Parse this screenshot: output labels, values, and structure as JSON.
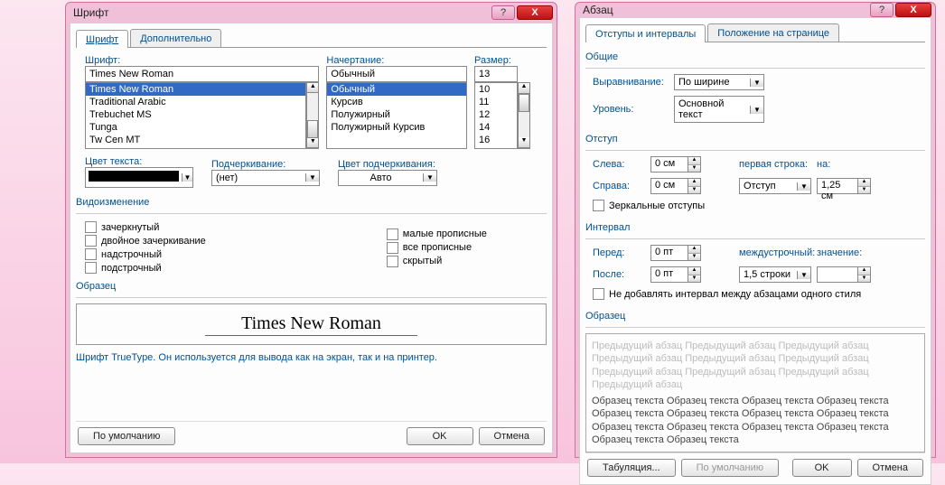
{
  "font_dialog": {
    "title": "Шрифт",
    "tabs": {
      "font": "Шрифт",
      "advanced": "Дополнительно"
    },
    "labels": {
      "font": "Шрифт:",
      "style": "Начертание:",
      "size": "Размер:",
      "text_color": "Цвет текста:",
      "underline": "Подчеркивание:",
      "underline_color": "Цвет подчеркивания:",
      "effects": "Видоизменение",
      "sample": "Образец"
    },
    "font_value": "Times New Roman",
    "font_list": [
      "Times New Roman",
      "Traditional Arabic",
      "Trebuchet MS",
      "Tunga",
      "Tw Cen MT"
    ],
    "style_value": "Обычный",
    "style_list": [
      "Обычный",
      "Курсив",
      "Полужирный",
      "Полужирный Курсив"
    ],
    "size_value": "13",
    "size_list": [
      "10",
      "11",
      "12",
      "14",
      "16"
    ],
    "underline_value": "(нет)",
    "underline_color_value": "Авто",
    "effects": {
      "strike": "зачеркнутый",
      "dstrike": "двойное зачеркивание",
      "super": "надстрочный",
      "sub": "подстрочный",
      "smallcaps": "малые прописные",
      "allcaps": "все прописные",
      "hidden": "скрытый"
    },
    "sample_text": "Times New Roman",
    "desc": "Шрифт TrueType. Он используется для вывода как на экран, так и на принтер.",
    "buttons": {
      "default": "По умолчанию",
      "ok": "OK",
      "cancel": "Отмена"
    }
  },
  "para_dialog": {
    "title": "Абзац",
    "tabs": {
      "indent": "Отступы и интервалы",
      "page": "Положение на странице"
    },
    "groups": {
      "general": "Общие",
      "indent": "Отступ",
      "interval": "Интервал",
      "sample": "Образец"
    },
    "labels": {
      "align": "Выравнивание:",
      "level": "Уровень:",
      "left": "Слева:",
      "right": "Справа:",
      "first": "первая строка:",
      "on": "на:",
      "before": "Перед:",
      "after": "После:",
      "linespacing": "междустрочный:",
      "value": "значение:",
      "mirror": "Зеркальные отступы",
      "nospace": "Не добавлять интервал между абзацами одного стиля"
    },
    "values": {
      "align": "По ширине",
      "level": "Основной текст",
      "left": "0 см",
      "right": "0 см",
      "first": "Отступ",
      "on": "1,25 см",
      "before": "0 пт",
      "after": "0 пт",
      "linespacing": "1,5 строки",
      "value": ""
    },
    "sample_prev": "Предыдущий абзац Предыдущий абзац Предыдущий абзац Предыдущий абзац Предыдущий абзац Предыдущий абзац Предыдущий абзац Предыдущий абзац Предыдущий абзац Предыдущий абзац",
    "sample_cur": "Образец текста Образец текста Образец текста Образец текста Образец текста Образец текста Образец текста Образец текста Образец текста Образец текста Образец текста Образец текста Образец текста Образец текста",
    "buttons": {
      "tabs": "Табуляция...",
      "default": "По умолчанию",
      "ok": "OK",
      "cancel": "Отмена"
    }
  }
}
